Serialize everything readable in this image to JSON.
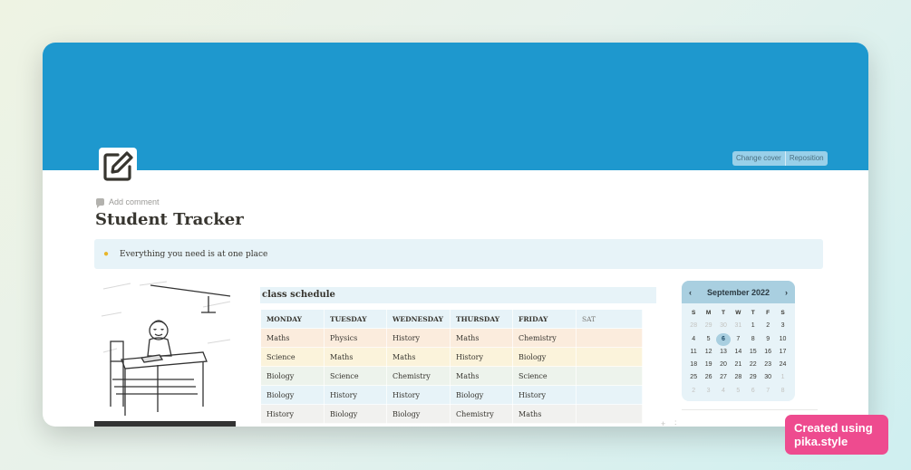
{
  "cover": {
    "color": "#1e98ce",
    "change_cover_label": "Change cover",
    "reposition_label": "Reposition"
  },
  "page": {
    "icon": "edit-icon",
    "add_comment_label": "Add comment",
    "title": "Student Tracker"
  },
  "callout": {
    "icon": "lightbulb-icon",
    "text": "Everything you need is at one place"
  },
  "illustration": {
    "description_icon": "student-at-desk-illustration"
  },
  "schedule": {
    "title": "class schedule",
    "headers": [
      "MONDAY",
      "TUESDAY",
      "WEDNESDAY",
      "THURSDAY",
      "FRIDAY",
      "SAT"
    ],
    "rows": [
      {
        "color": "#fbecdd",
        "cells": [
          "Maths",
          "Physics",
          "History",
          "Maths",
          "Chemistry",
          ""
        ]
      },
      {
        "color": "#fbf3db",
        "cells": [
          "Science",
          "Maths",
          "Maths",
          "History",
          "Biology",
          ""
        ]
      },
      {
        "color": "#edf3ec",
        "cells": [
          "Biology",
          "Science",
          "Chemistry",
          "Maths",
          "Science",
          ""
        ]
      },
      {
        "color": "#e7f3f8",
        "cells": [
          "Biology",
          "History",
          "History",
          "Biology",
          "History",
          ""
        ]
      },
      {
        "color": "#f1f1ef",
        "cells": [
          "History",
          "Biology",
          "Biology",
          "Chemistry",
          "Maths",
          ""
        ]
      }
    ]
  },
  "calendar": {
    "month_label": "September 2022",
    "prev_icon": "chevron-left-icon",
    "next_icon": "chevron-right-icon",
    "weekdays": [
      "S",
      "M",
      "T",
      "W",
      "T",
      "F",
      "S"
    ],
    "selected_day": "6",
    "weeks": [
      [
        "28",
        "29",
        "30",
        "31",
        "1",
        "2",
        "3"
      ],
      [
        "4",
        "5",
        "6",
        "7",
        "8",
        "9",
        "10"
      ],
      [
        "11",
        "12",
        "13",
        "14",
        "15",
        "16",
        "17"
      ],
      [
        "18",
        "19",
        "20",
        "21",
        "22",
        "23",
        "24"
      ],
      [
        "25",
        "26",
        "27",
        "28",
        "29",
        "30",
        "1"
      ],
      [
        "2",
        "3",
        "4",
        "5",
        "6",
        "7",
        "8"
      ]
    ]
  },
  "watermark": {
    "line1": "Created using",
    "line2": "pika.style"
  }
}
